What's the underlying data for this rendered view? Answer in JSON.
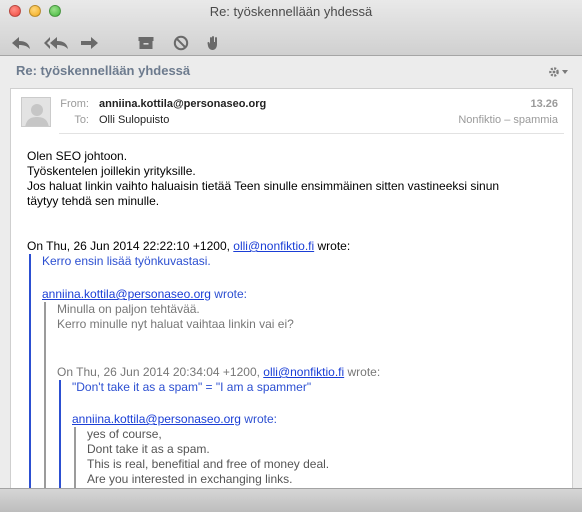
{
  "window": {
    "title": "Re: työskennellään yhdessä"
  },
  "toolbar": {
    "icons": [
      "reply-icon",
      "reply-all-icon",
      "forward-icon",
      "archive-icon",
      "junk-icon",
      "flag-icon"
    ]
  },
  "subject_bar": {
    "subject": "Re: työskennellään yhdessä",
    "settings_icon": "gear-icon"
  },
  "message": {
    "from_label": "From:",
    "from_value": "anniina.kottila@personaseo.org",
    "to_label": "To:",
    "to_value": "Olli Sulopuisto",
    "time": "13.26",
    "mailbox": "Nonfiktio – spammia",
    "body_lines": [
      "Olen SEO johtoon.",
      "Työskentelen joillekin yrityksille.",
      "Jos haluat linkin vaihto haluaisin tietää Teen sinulle ensimmäinen sitten vastineeksi sinun",
      "täytyy tehdä sen minulle."
    ],
    "quote1": {
      "attrib_prefix": "On Thu, 26 Jun 2014 22:22:10 +1200, ",
      "attrib_link": "olli@nonfiktio.fi",
      "attrib_suffix": " wrote:",
      "lines": [
        "Kerro ensin lisää työnkuvastasi."
      ],
      "quote2": {
        "attrib_link": "anniina.kottila@personaseo.org",
        "attrib_suffix": " wrote:",
        "lines": [
          "Minulla on paljon tehtävää.",
          "Kerro minulle nyt haluat vaihtaa linkin vai ei?"
        ],
        "quote3": {
          "attrib_prefix": "On Thu, 26 Jun 2014 20:34:04 +1200, ",
          "attrib_link": "olli@nonfiktio.fi",
          "attrib_suffix": " wrote:",
          "lines": [
            "\"Don't take it as a spam\" = \"I am a spammer\""
          ],
          "quote4": {
            "attrib_link": "anniina.kottila@personaseo.org",
            "attrib_suffix": " wrote:",
            "lines": [
              "yes of course,",
              "Dont take it as a spam.",
              "This is real, benefitial and free of money deal.",
              "Are you interested in exchanging links."
            ]
          }
        }
      }
    }
  },
  "colors": {
    "subject": "#6d7b8e",
    "link": "#1a3ed6",
    "quote_blue": "#2c4fd1",
    "quote_gray": "#9b9b9b"
  }
}
